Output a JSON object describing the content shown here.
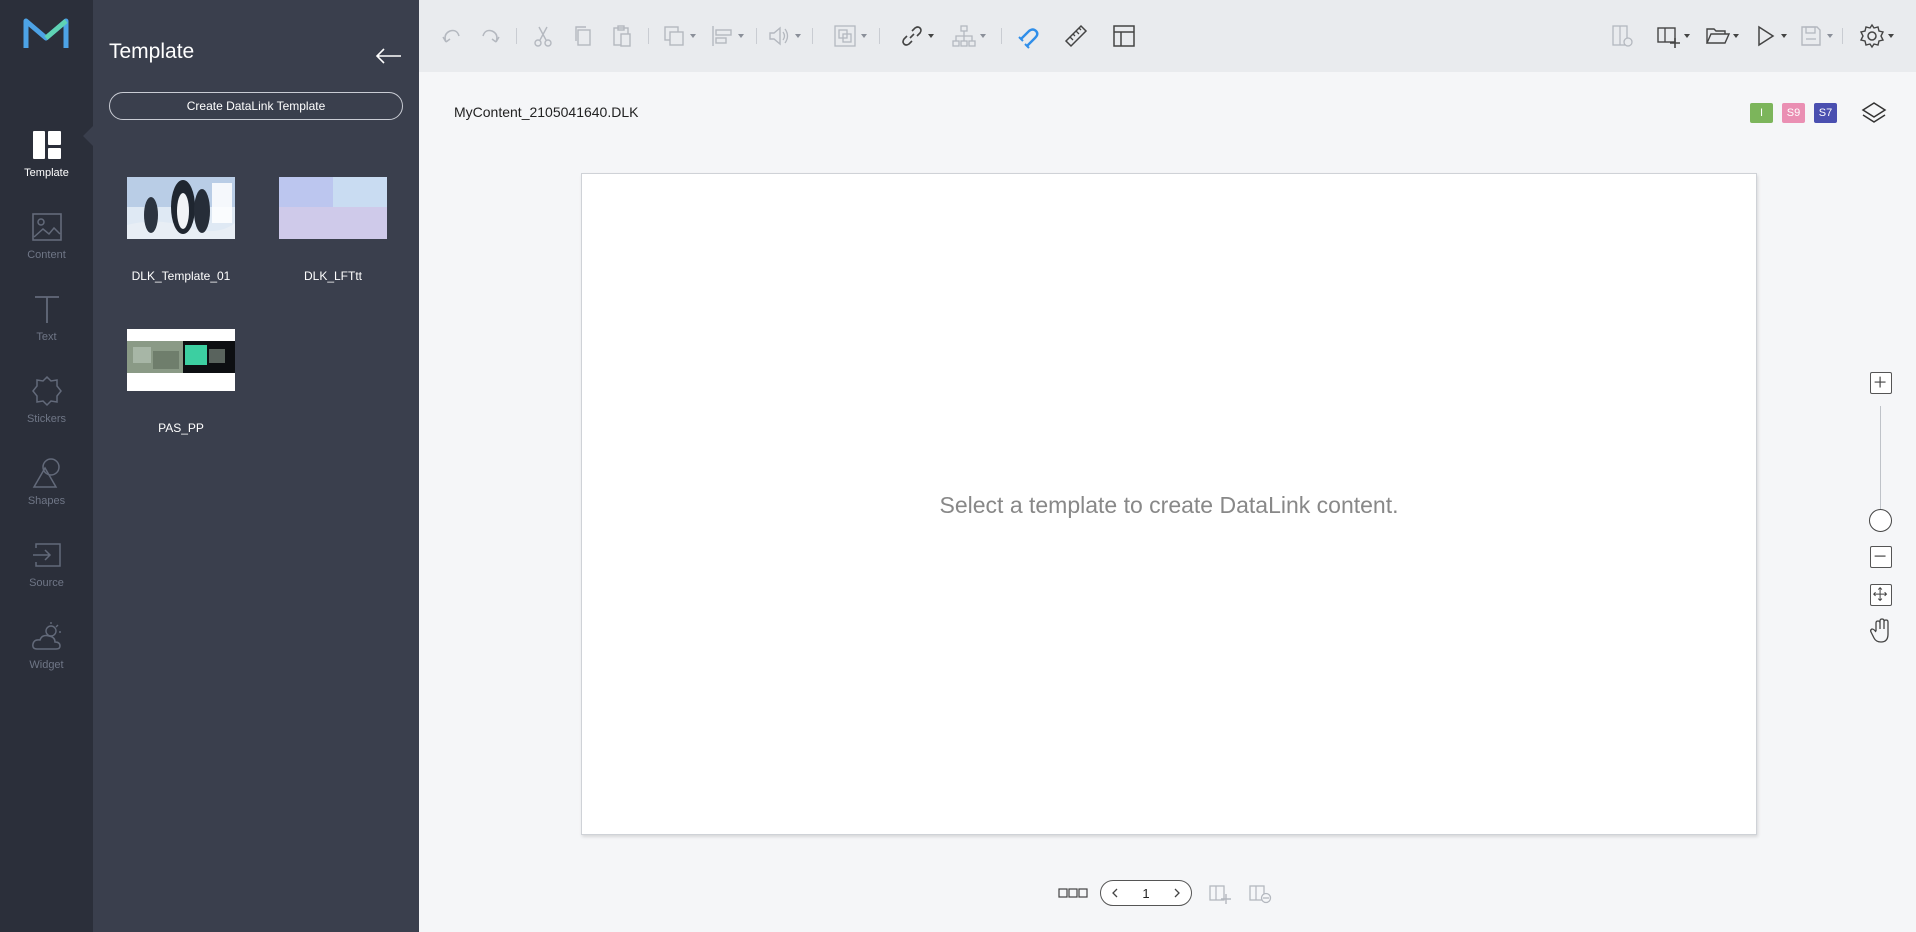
{
  "rail": {
    "items": [
      {
        "label": "Template",
        "icon": "template-icon",
        "active": true
      },
      {
        "label": "Content",
        "icon": "image-icon"
      },
      {
        "label": "Text",
        "icon": "text-icon"
      },
      {
        "label": "Stickers",
        "icon": "sticker-icon"
      },
      {
        "label": "Shapes",
        "icon": "shapes-icon"
      },
      {
        "label": "Source",
        "icon": "source-icon"
      },
      {
        "label": "Widget",
        "icon": "weather-icon"
      }
    ]
  },
  "panel": {
    "title": "Template",
    "create_button": "Create DataLink Template",
    "templates": [
      {
        "name": "DLK_Template_01"
      },
      {
        "name": "DLK_LFTtt"
      },
      {
        "name": "PAS_PP"
      }
    ]
  },
  "document": {
    "filename": "MyContent_2105041640.DLK",
    "badges": [
      {
        "text": "I",
        "color": "#7cb55b"
      },
      {
        "text": "S9",
        "color": "#ea8fb3"
      },
      {
        "text": "S7",
        "color": "#4a4fb0"
      }
    ],
    "canvas_message": "Select a template to create DataLink content."
  },
  "pager": {
    "page": "1"
  },
  "colors": {
    "accent": "#2f8ee9",
    "rail_bg": "#2b2f3a",
    "panel_bg": "#3a3f4d"
  }
}
